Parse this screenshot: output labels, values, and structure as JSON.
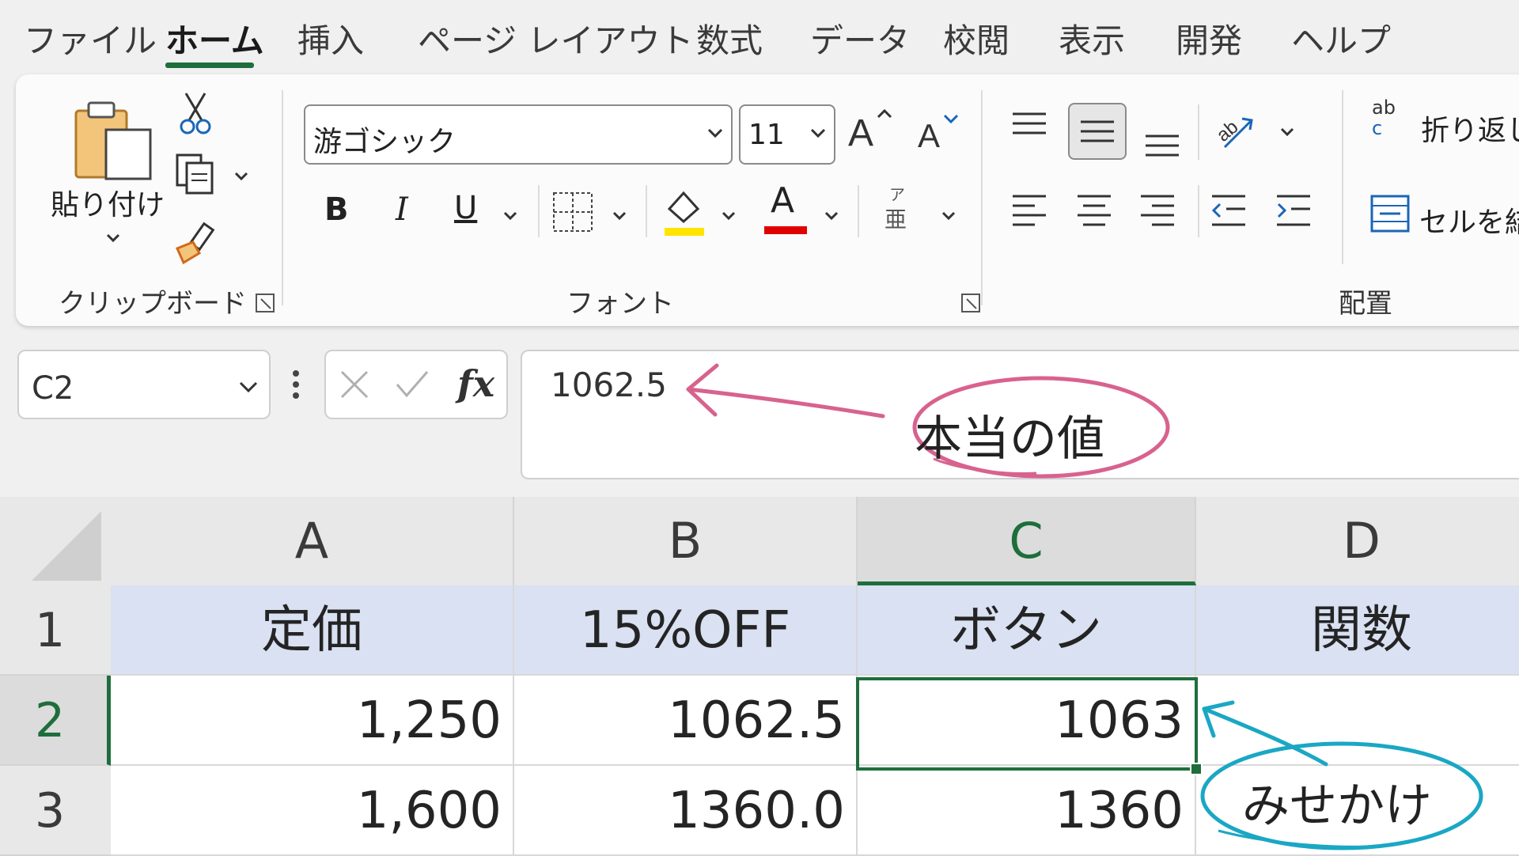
{
  "tabs": [
    {
      "label": "ファイル"
    },
    {
      "label": "ホーム"
    },
    {
      "label": "挿入"
    },
    {
      "label": "ページ レイアウト"
    },
    {
      "label": "数式"
    },
    {
      "label": "データ"
    },
    {
      "label": "校閲"
    },
    {
      "label": "表示"
    },
    {
      "label": "開発"
    },
    {
      "label": "ヘルプ"
    }
  ],
  "ribbon": {
    "clipboard": {
      "paste_label": "貼り付け",
      "group_label": "クリップボード"
    },
    "font": {
      "font_name": "游ゴシック",
      "font_size": "11",
      "bold": "B",
      "italic": "I",
      "underline": "U",
      "font_color_glyph": "A",
      "phonetic_top": "ア",
      "phonetic_bottom": "亜",
      "group_label": "フォント",
      "highlight_color": "#ffe400",
      "font_color": "#e00000"
    },
    "alignment": {
      "wrap_text": "折り返し",
      "merge_cells": "セルを結",
      "group_label": "配置",
      "wrap_icon_top": "ab",
      "wrap_icon_bottom": "c"
    }
  },
  "formula_bar": {
    "name_box": "C2",
    "fx": "fx",
    "value": "1062.5"
  },
  "grid": {
    "columns": [
      "A",
      "B",
      "C",
      "D"
    ],
    "rows": [
      "1",
      "2",
      "3"
    ],
    "header_row": [
      "定価",
      "15%OFF",
      "ボタン",
      "関数"
    ],
    "data": [
      [
        "1,250",
        "1062.5",
        "1063",
        ""
      ],
      [
        "1,600",
        "1360.0",
        "1360",
        ""
      ]
    ],
    "selected_cell": "C2",
    "accent_color": "#1e6e3c",
    "header_fill": "#d9e1f2"
  },
  "annotations": {
    "true_value": "本当の値",
    "appearance": "みせかけ",
    "pink": "#d8628e",
    "cyan": "#1aa7c4"
  }
}
